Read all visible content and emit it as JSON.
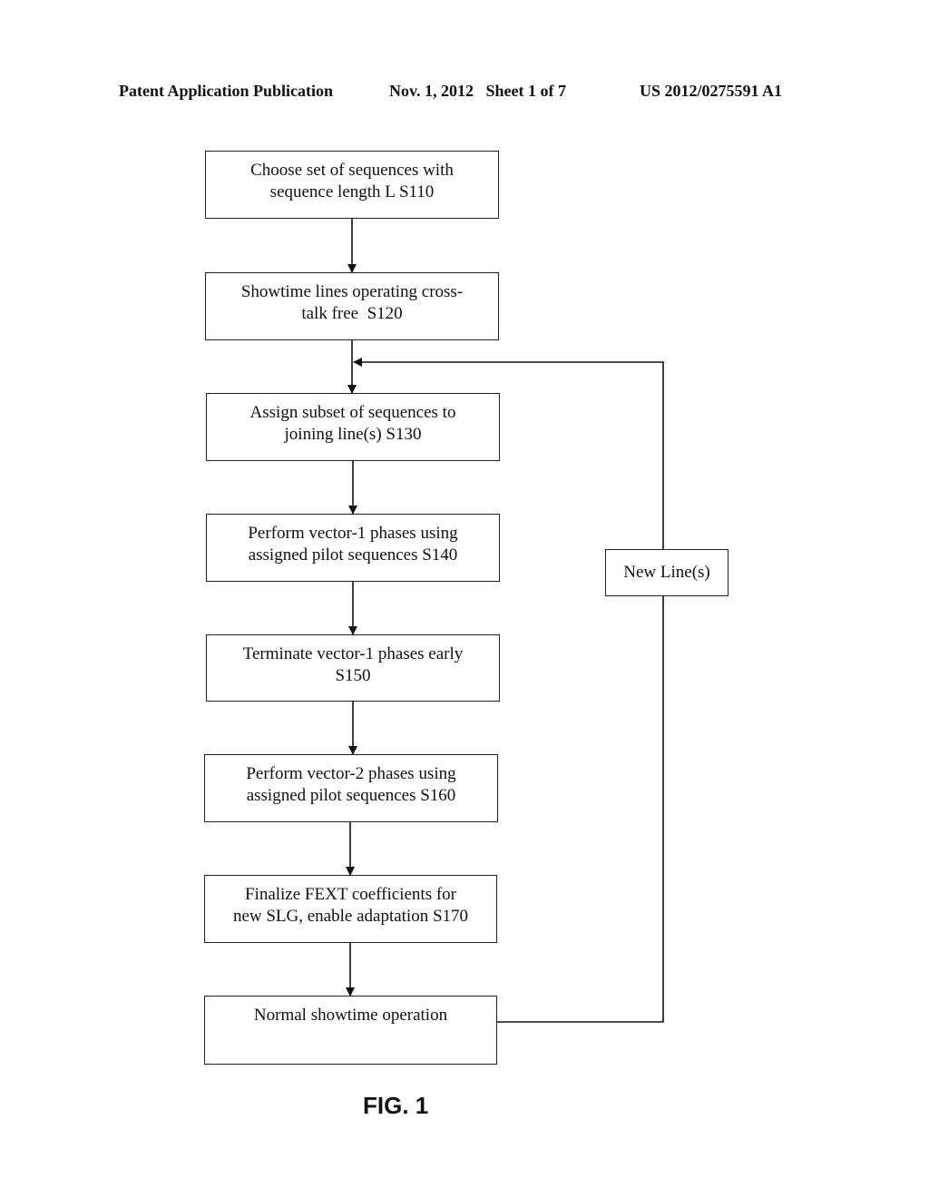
{
  "header": {
    "publication": "Patent Application Publication",
    "date_sheet": "Nov. 1, 2012   Sheet 1 of 7",
    "number": "US 2012/0275591 A1"
  },
  "flowchart": {
    "steps": [
      {
        "id": "S110",
        "lines": [
          "Choose set of sequences with",
          "sequence length L S110"
        ]
      },
      {
        "id": "S120",
        "lines": [
          "Showtime lines operating cross-",
          "talk free  S120"
        ]
      },
      {
        "id": "S130",
        "lines": [
          "Assign subset of sequences to",
          "joining line(s) S130"
        ]
      },
      {
        "id": "S140",
        "lines": [
          "Perform vector-1 phases using",
          "assigned pilot sequences S140"
        ]
      },
      {
        "id": "S150",
        "lines": [
          "Terminate vector-1 phases early",
          "S150"
        ]
      },
      {
        "id": "S160",
        "lines": [
          "Perform vector-2 phases using",
          "assigned pilot sequences S160"
        ]
      },
      {
        "id": "S170",
        "lines": [
          "Finalize FEXT coefficients for",
          "new SLG, enable adaptation S170"
        ]
      },
      {
        "id": "normal",
        "lines": [
          "Normal showtime operation"
        ]
      }
    ],
    "loop_label": "New Line(s)"
  },
  "figure_caption": "FIG. 1"
}
